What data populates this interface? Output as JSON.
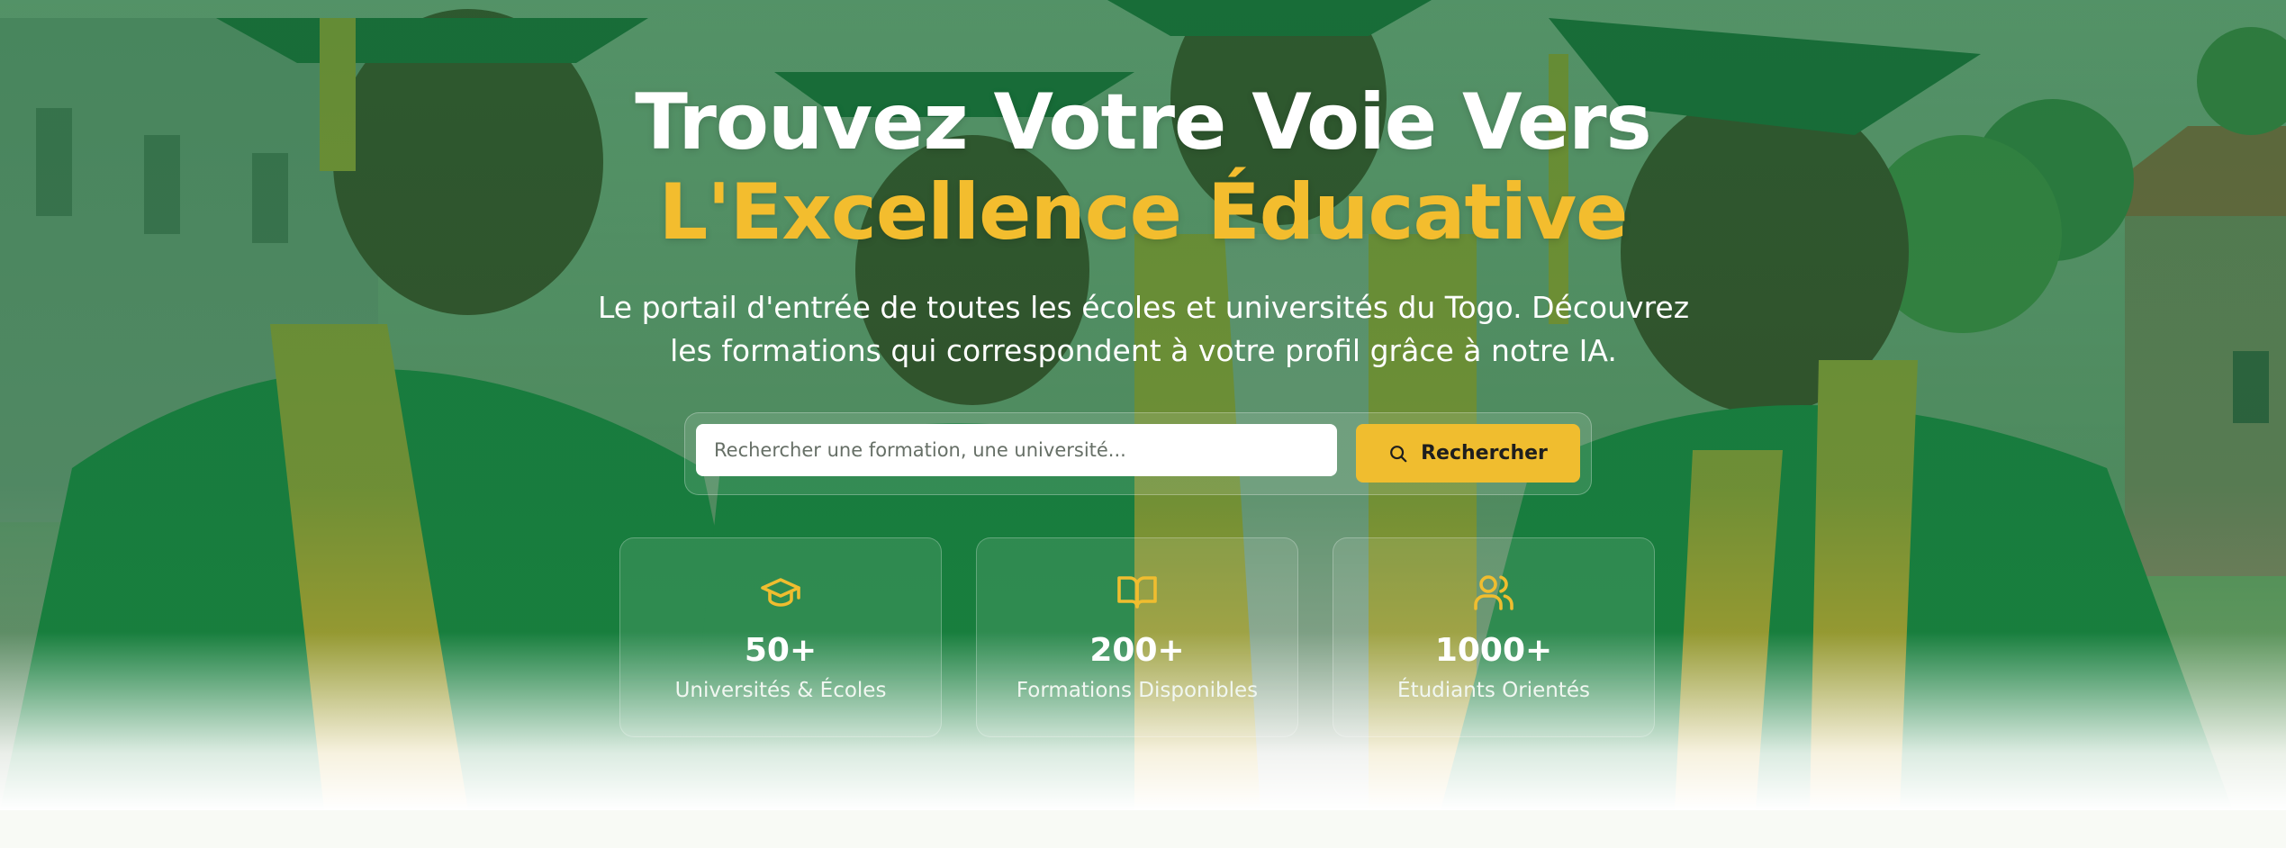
{
  "hero": {
    "title_line1": "Trouvez Votre Voie Vers",
    "title_line2": "L'Excellence Éducative",
    "subtitle": "Le portail d'entrée de toutes les écoles et universités du Togo. Découvrez les formations qui correspondent à votre profil grâce à notre IA."
  },
  "search": {
    "placeholder": "Rechercher une formation, une université...",
    "value": "",
    "button_label": "Rechercher"
  },
  "stats": [
    {
      "icon": "graduation-cap-icon",
      "value": "50+",
      "label": "Universités & Écoles"
    },
    {
      "icon": "open-book-icon",
      "value": "200+",
      "label": "Formations Disponibles"
    },
    {
      "icon": "users-icon",
      "value": "1000+",
      "label": "Étudiants Orientés"
    }
  ],
  "colors": {
    "accent": "#f0bd2f",
    "overlay_green": "#1a783e",
    "title_text": "#ffffff"
  }
}
